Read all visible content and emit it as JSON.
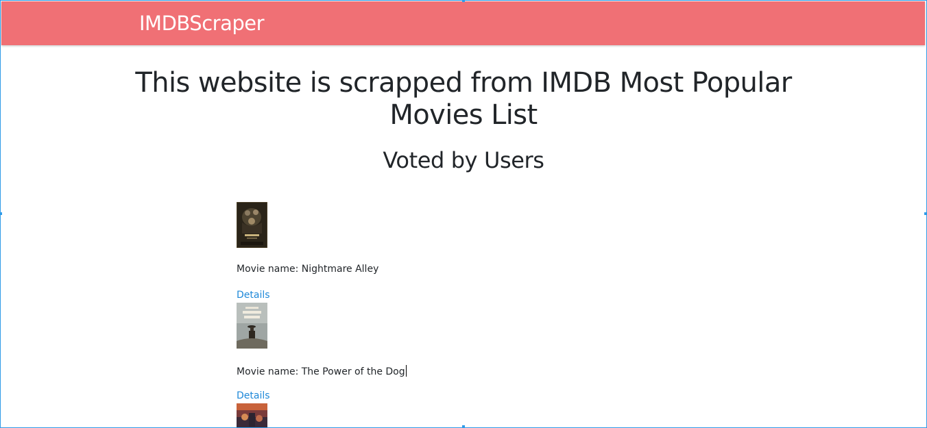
{
  "navbar": {
    "brand": "IMDBScraper",
    "color": "#f07075"
  },
  "main": {
    "title": "This website is scrapped from IMDB Most Popular Movies List",
    "subtitle": "Voted by Users"
  },
  "movies": [
    {
      "label": "Movie name: Nightmare Alley",
      "details_label": "Details",
      "poster_icon": "nightmare-alley-poster"
    },
    {
      "label": "Movie name: The Power of the Dog",
      "details_label": "Details",
      "poster_icon": "power-of-the-dog-poster"
    },
    {
      "poster_icon": "movie-poster-partial"
    }
  ],
  "colors": {
    "accent": "#f07075",
    "link": "#1e88d8",
    "selection_border": "#2f9be8"
  }
}
